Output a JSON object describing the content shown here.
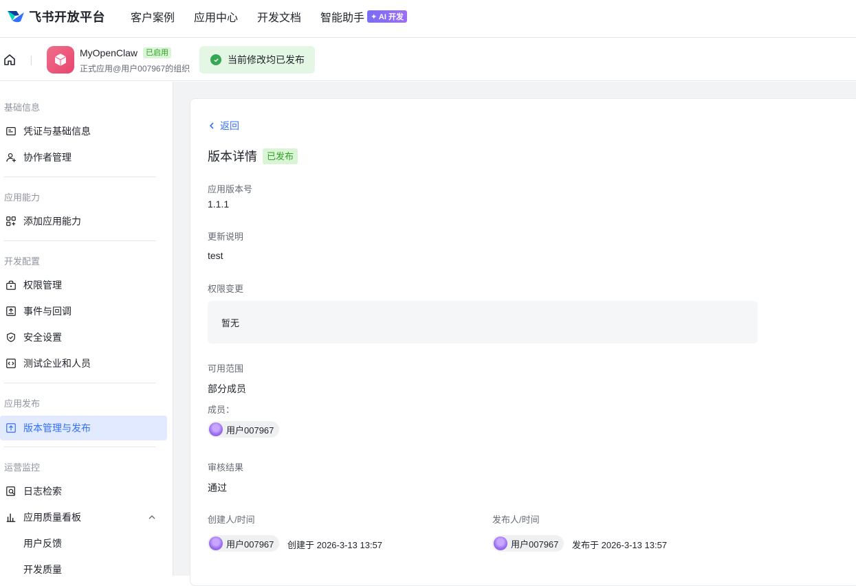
{
  "topnav": {
    "logo_text": "飞书开放平台",
    "items": [
      "客户案例",
      "应用中心",
      "开发文档",
      "智能助手"
    ],
    "ai_badge": "✦ AI 开发"
  },
  "appbar": {
    "app_name": "MyOpenClaw",
    "app_status": "已启用",
    "app_org": "正式应用@用户007967的组织",
    "publish_state": "当前修改均已发布"
  },
  "sidebar": {
    "sections": [
      {
        "title": "基础信息",
        "items": [
          "凭证与基础信息",
          "协作者管理"
        ]
      },
      {
        "title": "应用能力",
        "items": [
          "添加应用能力"
        ]
      },
      {
        "title": "开发配置",
        "items": [
          "权限管理",
          "事件与回调",
          "安全设置",
          "测试企业和人员"
        ]
      },
      {
        "title": "应用发布",
        "items": [
          "版本管理与发布"
        ]
      },
      {
        "title": "运营监控",
        "items": [
          "日志检索",
          "应用质量看板",
          "用户反馈",
          "开发质量"
        ]
      }
    ],
    "active_item": "版本管理与发布"
  },
  "main": {
    "back_label": "返回",
    "page_title": "版本详情",
    "status_badge": "已发布",
    "version_label": "应用版本号",
    "version_value": "1.1.1",
    "notes_label": "更新说明",
    "notes_value": "test",
    "perm_label": "权限变更",
    "perm_value": "暂无",
    "scope_label": "可用范围",
    "scope_value": "部分成员",
    "members_label": "成员：",
    "member_name": "用户007967",
    "review_label": "审核结果",
    "review_value": "通过",
    "creator_label": "创建人/时间",
    "creator_name": "用户007967",
    "creator_time": "创建于 2026-3-13 13:57",
    "publisher_label": "发布人/时间",
    "publisher_name": "用户007967",
    "publisher_time": "发布于 2026-3-13 13:57"
  }
}
